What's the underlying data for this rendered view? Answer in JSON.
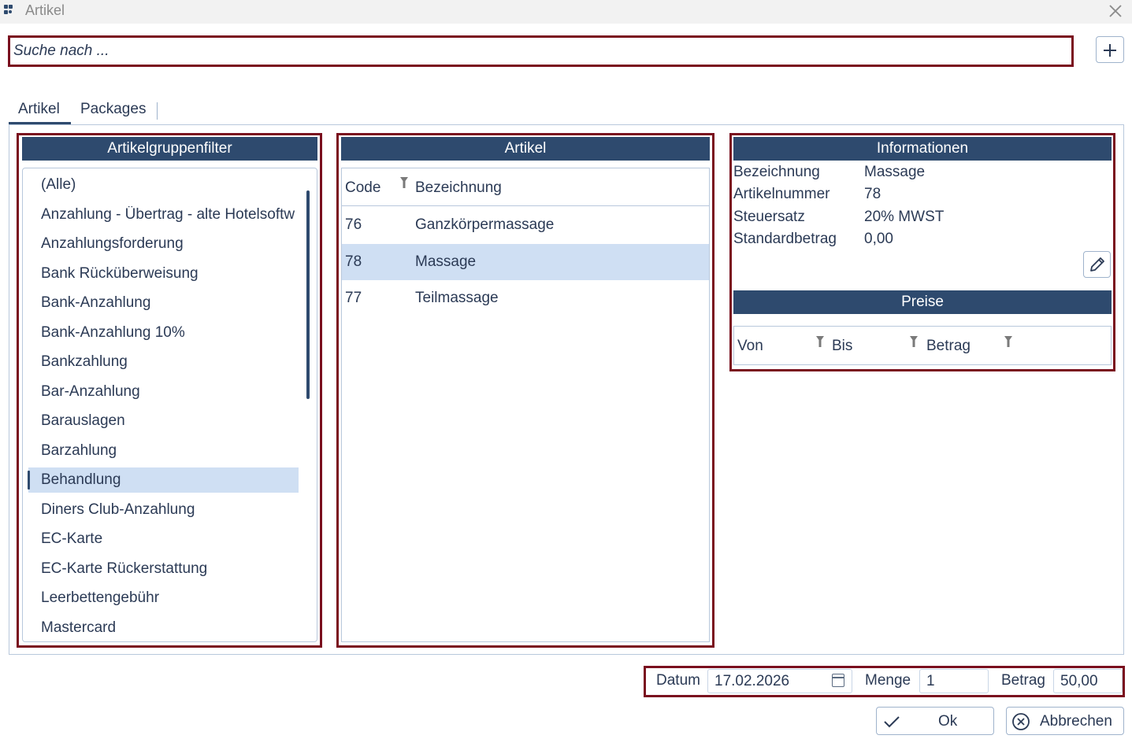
{
  "window": {
    "title": "Artikel",
    "close_icon": "close-icon"
  },
  "search": {
    "placeholder": "Suche nach ..."
  },
  "tabs": [
    {
      "label": "Artikel",
      "active": true
    },
    {
      "label": "Packages",
      "active": false
    }
  ],
  "groups_panel": {
    "header": "Artikelgruppenfilter",
    "items": [
      "(Alle)",
      "Anzahlung - Übertrag - alte Hotelsoftw",
      "Anzahlungsforderung",
      "Bank Rücküberweisung",
      "Bank-Anzahlung",
      "Bank-Anzahlung 10%",
      "Bankzahlung",
      "Bar-Anzahlung",
      "Barauslagen",
      "Barzahlung",
      "Behandlung",
      "Diners Club-Anzahlung",
      "EC-Karte",
      "EC-Karte Rückerstattung",
      "Leerbettengebühr",
      "Mastercard"
    ],
    "selected": "Behandlung"
  },
  "articles_panel": {
    "header": "Artikel",
    "columns": {
      "code": "Code",
      "name": "Bezeichnung"
    },
    "rows": [
      {
        "code": "76",
        "name": "Ganzkörpermassage"
      },
      {
        "code": "78",
        "name": "Massage",
        "selected": true
      },
      {
        "code": "77",
        "name": "Teilmassage"
      }
    ]
  },
  "info_panel": {
    "header": "Informationen",
    "fields": [
      {
        "label": "Bezeichnung",
        "value": "Massage"
      },
      {
        "label": "Artikelnummer",
        "value": "78"
      },
      {
        "label": "Steuersatz",
        "value": "20% MWST"
      },
      {
        "label": "Standardbetrag",
        "value": "0,00"
      }
    ],
    "prices_header": "Preise",
    "prices_columns": {
      "from": "Von",
      "to": "Bis",
      "amount": "Betrag"
    }
  },
  "footer": {
    "date_label": "Datum",
    "date_value": "17.02.2026",
    "quantity_label": "Menge",
    "quantity_value": "1",
    "amount_label": "Betrag",
    "amount_value": "50,00"
  },
  "buttons": {
    "ok": "Ok",
    "cancel": "Abbrechen"
  },
  "colors": {
    "accent": "#2e4a6e",
    "selection": "#cfdff3",
    "highlight_frame": "#7a0f1e",
    "border": "#b8c8dc"
  }
}
